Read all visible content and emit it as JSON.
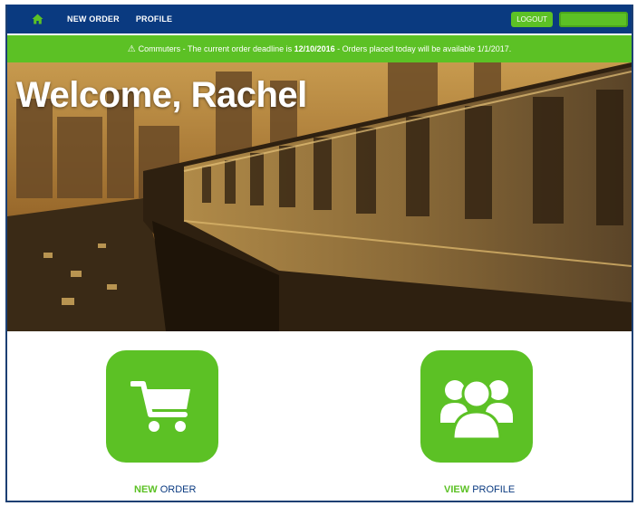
{
  "nav": {
    "home_icon": "home-icon",
    "links": [
      "NEW ORDER",
      "PROFILE"
    ],
    "logout_label": "LOGOUT"
  },
  "alert": {
    "icon": "warning-icon",
    "text_before": "Commuters - The current order deadline is",
    "deadline": "12/10/2016",
    "text_after": "- Orders placed today will be available 1/1/2017."
  },
  "hero": {
    "welcome": "Welcome, Rachel"
  },
  "actions": [
    {
      "icon": "shopping-cart-icon",
      "accent": "NEW",
      "label": "ORDER"
    },
    {
      "icon": "users-group-icon",
      "accent": "VIEW",
      "label": "PROFILE"
    }
  ],
  "colors": {
    "navy": "#0a3a80",
    "green": "#5cc125"
  }
}
